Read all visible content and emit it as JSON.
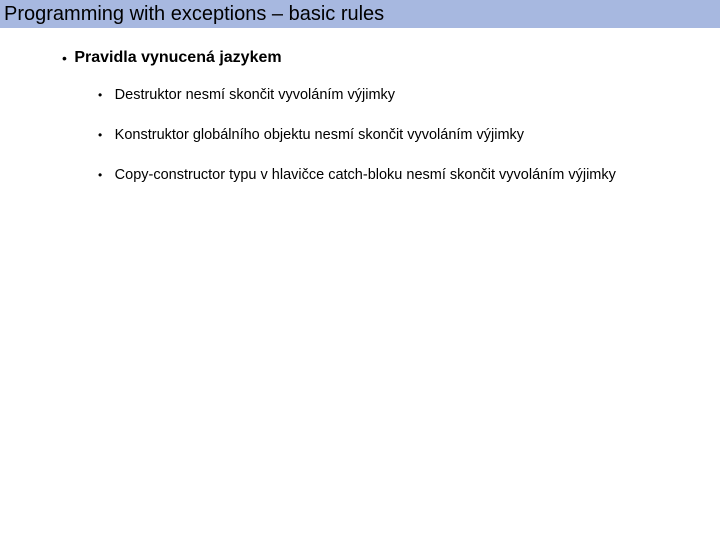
{
  "title": "Programming with exceptions – basic rules",
  "main": {
    "heading": "Pravidla vynucená jazykem",
    "items": [
      "Destruktor nesmí skončit vyvoláním výjimky",
      "Konstruktor globálního objektu nesmí skončit vyvoláním výjimky",
      "Copy-constructor typu v hlavičce catch-bloku nesmí skončit vyvoláním výjimky"
    ]
  }
}
